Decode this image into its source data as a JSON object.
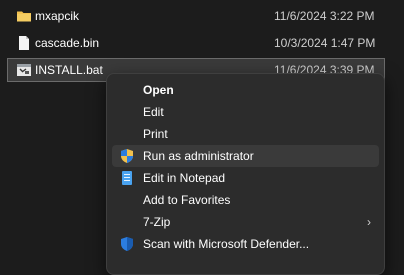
{
  "files": [
    {
      "name": "mxapcik",
      "date": "11/6/2024 3:22 PM",
      "icon": "folder-icon"
    },
    {
      "name": "cascade.bin",
      "date": "10/3/2024 1:47 PM",
      "icon": "file-icon"
    },
    {
      "name": "INSTALL.bat",
      "date": "11/6/2024 3:39 PM",
      "icon": "batch-file-icon"
    }
  ],
  "context_menu": {
    "items": [
      {
        "label": "Open"
      },
      {
        "label": "Edit"
      },
      {
        "label": "Print"
      },
      {
        "label": "Run as administrator",
        "icon": "shield-icon"
      },
      {
        "label": "Edit in Notepad",
        "icon": "notepad-icon"
      },
      {
        "label": "Add to Favorites"
      },
      {
        "label": "7-Zip",
        "icon": "chevron-right-icon"
      },
      {
        "label": "Scan with Microsoft Defender...",
        "icon": "defender-shield-icon"
      }
    ]
  },
  "colors": {
    "background": "#1c1c1c",
    "menu_background": "#2c2c2c",
    "hover": "#3a3a3a",
    "folder": "#f2c14e",
    "accent_blue": "#2b7de0"
  }
}
